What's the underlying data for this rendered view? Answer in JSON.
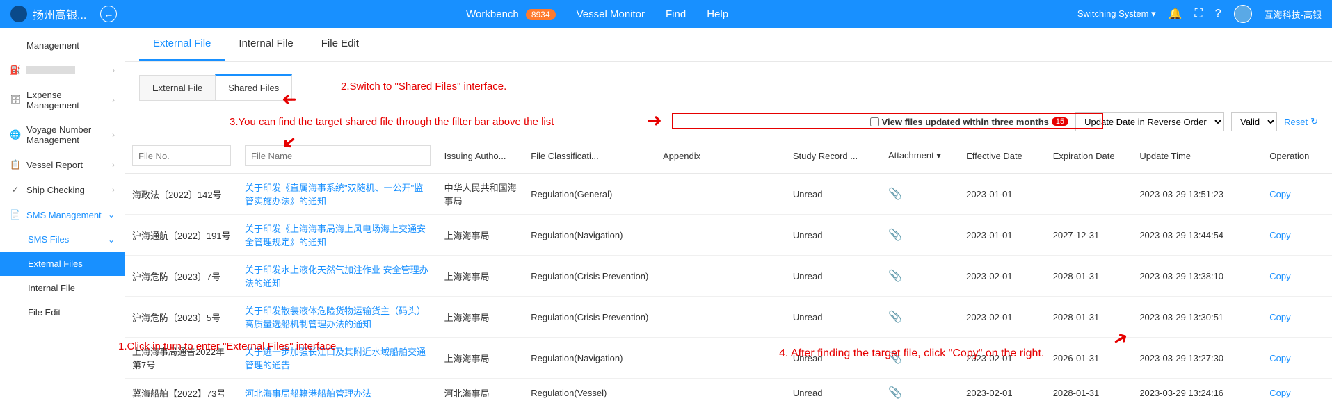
{
  "topbar": {
    "app_name": "扬州高银...",
    "workbench_label": "Workbench",
    "workbench_badge": "8934",
    "vessel_monitor": "Vessel Monitor",
    "find": "Find",
    "help": "Help",
    "switching_system": "Switching System",
    "user_name": "互海科技-高银"
  },
  "sidebar": {
    "items": [
      {
        "icon": "",
        "label": "Management",
        "chev": ""
      },
      {
        "icon": "⛽",
        "label": "",
        "chev": "›"
      },
      {
        "icon": "🗄",
        "label": "Expense Management",
        "chev": "›"
      },
      {
        "icon": "🌐",
        "label": "Voyage Number Management",
        "chev": "›"
      },
      {
        "icon": "📋",
        "label": "Vessel Report",
        "chev": "›"
      },
      {
        "icon": "✓",
        "label": "Ship Checking",
        "chev": "›"
      }
    ],
    "sms": {
      "label": "SMS Management",
      "files_label": "SMS Files",
      "external": "External Files",
      "internal": "Internal File",
      "fileedit": "File Edit"
    }
  },
  "tabs1": {
    "external": "External File",
    "internal": "Internal File",
    "fileedit": "File Edit"
  },
  "tabs2": {
    "external": "External File",
    "shared": "Shared Files"
  },
  "filter": {
    "view_three_months": "View files updated within three months",
    "badge": "15",
    "sort_option": "Update Date in Reverse Order",
    "valid_option": "Valid",
    "reset": "Reset"
  },
  "columns": {
    "file_no_ph": "File No.",
    "file_name_ph": "File Name",
    "issuing": "Issuing Autho...",
    "classification": "File Classificati...",
    "appendix": "Appendix",
    "study": "Study Record ...",
    "attachment": "Attachment",
    "effective": "Effective Date",
    "expiration": "Expiration Date",
    "update": "Update Time",
    "operation": "Operation"
  },
  "rows": [
    {
      "file_no": "海政法〔2022〕142号",
      "file_name": "关于印发《直属海事系统\"双随机、一公开\"监管实施办法》的通知",
      "issuing": "中华人民共和国海事局",
      "classification": "Regulation(General)",
      "study": "Unread",
      "effective": "2023-01-01",
      "expiration": "",
      "update": "2023-03-29 13:51:23",
      "op": "Copy"
    },
    {
      "file_no": "沪海通航〔2022〕191号",
      "file_name": "关于印发《上海海事局海上风电场海上交通安全管理规定》的通知",
      "issuing": "上海海事局",
      "classification": "Regulation(Navigation)",
      "study": "Unread",
      "effective": "2023-01-01",
      "expiration": "2027-12-31",
      "update": "2023-03-29 13:44:54",
      "op": "Copy"
    },
    {
      "file_no": "沪海危防〔2023〕7号",
      "file_name": "关于印发水上液化天然气加注作业 安全管理办法的通知",
      "issuing": "上海海事局",
      "classification": "Regulation(Crisis Prevention)",
      "study": "Unread",
      "effective": "2023-02-01",
      "expiration": "2028-01-31",
      "update": "2023-03-29 13:38:10",
      "op": "Copy"
    },
    {
      "file_no": "沪海危防〔2023〕5号",
      "file_name": "关于印发散装液体危险货物运输货主（码头）高质量选船机制管理办法的通知",
      "issuing": "上海海事局",
      "classification": "Regulation(Crisis Prevention)",
      "study": "Unread",
      "effective": "2023-02-01",
      "expiration": "2028-01-31",
      "update": "2023-03-29 13:30:51",
      "op": "Copy"
    },
    {
      "file_no": "上海海事局通告2022年第7号",
      "file_name": "关于进一步加强长江口及其附近水域船舶交通管理的通告",
      "issuing": "上海海事局",
      "classification": "Regulation(Navigation)",
      "study": "Unread",
      "effective": "2023-02-01",
      "expiration": "2026-01-31",
      "update": "2023-03-29 13:27:30",
      "op": "Copy"
    },
    {
      "file_no": "冀海船舶【2022】73号",
      "file_name": "河北海事局船籍港船舶管理办法",
      "issuing": "河北海事局",
      "classification": "Regulation(Vessel)",
      "study": "Unread",
      "effective": "2023-02-01",
      "expiration": "2028-01-31",
      "update": "2023-03-29 13:24:16",
      "op": "Copy"
    }
  ],
  "annotations": {
    "a1": "1.Click in turn to enter \"External Files\" interface",
    "a2": "2.Switch to \"Shared Files\" interface.",
    "a3": "3.You can find the target shared file through the filter bar above the list",
    "a4": "4. After finding the target file, click \"Copy\" on the right."
  }
}
